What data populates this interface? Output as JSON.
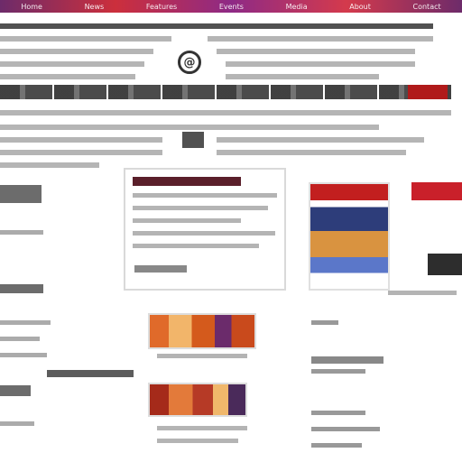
{
  "top_nav": {
    "items": [
      "Home",
      "News",
      "Features",
      "Events",
      "Media",
      "About",
      "Contact"
    ]
  },
  "logo": {
    "glyph": "@"
  },
  "main": {
    "card_image": {
      "caption": ""
    }
  },
  "colors": {
    "brand_purple": "#6d2b6a",
    "brand_red": "#c21f1f",
    "text_gray": "#777777"
  },
  "icons": {
    "logo": "logo-icon"
  }
}
